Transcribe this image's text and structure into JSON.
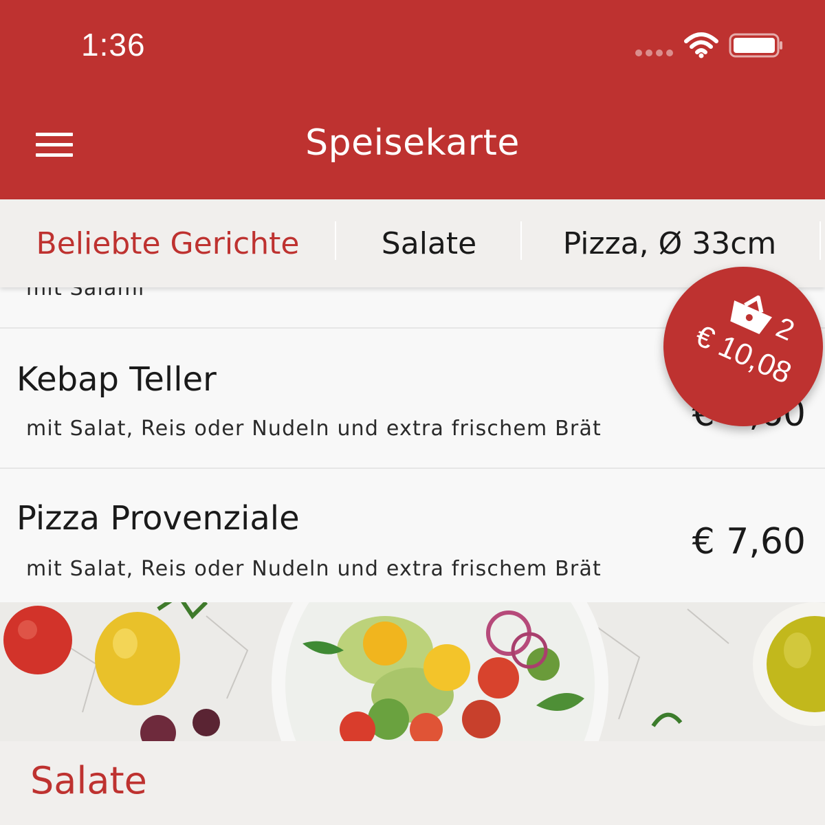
{
  "status_bar": {
    "time": "1:36"
  },
  "header": {
    "title": "Speisekarte",
    "menu_icon": "hamburger-menu-icon"
  },
  "tabs": [
    {
      "label": "Beliebte Gerichte",
      "active": true
    },
    {
      "label": "Salate",
      "active": false
    },
    {
      "label": "Pizza, Ø 33cm",
      "active": false
    }
  ],
  "menu_items": [
    {
      "title": "",
      "description": "mit Salami",
      "price": ""
    },
    {
      "title": "Kebap Teller",
      "description": "mit Salat, Reis oder Nudeln und extra frischem Brät",
      "price": "€ 7,60"
    },
    {
      "title": "Pizza Provenziale",
      "description": "mit Salat, Reis oder Nudeln und extra frischem Brät",
      "price": "€ 7,60"
    }
  ],
  "cart": {
    "icon": "shopping-basket-icon",
    "count": "2",
    "total": "€ 10,08"
  },
  "section": {
    "title": "Salate"
  },
  "colors": {
    "brand_red": "#be3230",
    "tab_bar_bg": "#f1efed",
    "list_bg": "#f8f8f8"
  }
}
